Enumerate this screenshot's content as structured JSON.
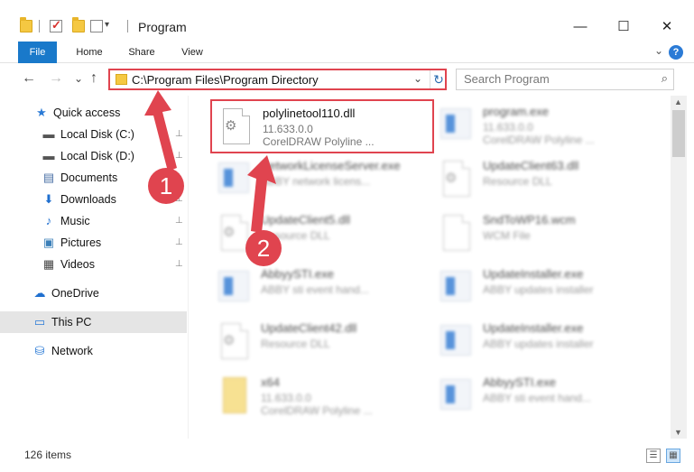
{
  "window": {
    "title": "Program",
    "minimize": "—",
    "maximize": "☐",
    "close": "✕"
  },
  "ribbon": {
    "tabs": [
      "File",
      "Home",
      "Share",
      "View"
    ],
    "expand": "⌄",
    "help": "?"
  },
  "nav": {
    "back": "←",
    "forward": "→",
    "recent": "⌄",
    "up": "↑",
    "address": "C:\\Program Files\\Program Directory",
    "address_dropdown": "⌄",
    "refresh": "↻",
    "search_placeholder": "Search Program",
    "search_icon": "⌕"
  },
  "sidebar": {
    "items": [
      {
        "label": "Quick access",
        "icon": "star-icon",
        "glyph": "★",
        "color": "#2b7bd6",
        "pinned": false
      },
      {
        "label": "Local Disk (C:)",
        "icon": "drive-icon",
        "glyph": "▬",
        "color": "#555555",
        "pinned": true
      },
      {
        "label": "Local Disk (D:)",
        "icon": "drive-icon",
        "glyph": "▬",
        "color": "#555555",
        "pinned": true
      },
      {
        "label": "Documents",
        "icon": "documents-icon",
        "glyph": "▤",
        "color": "#4a6fa5",
        "pinned": true
      },
      {
        "label": "Downloads",
        "icon": "download-icon",
        "glyph": "⬇",
        "color": "#1f6fcf",
        "pinned": true
      },
      {
        "label": "Music",
        "icon": "music-icon",
        "glyph": "♪",
        "color": "#1f6fcf",
        "pinned": true
      },
      {
        "label": "Pictures",
        "icon": "pictures-icon",
        "glyph": "▣",
        "color": "#3b7fb8",
        "pinned": true
      },
      {
        "label": "Videos",
        "icon": "videos-icon",
        "glyph": "▦",
        "color": "#444444",
        "pinned": true
      },
      {
        "label": "OneDrive",
        "icon": "cloud-icon",
        "glyph": "☁",
        "color": "#1f6fcf",
        "pinned": false
      },
      {
        "label": "This PC",
        "icon": "computer-icon",
        "glyph": "▭",
        "color": "#2b7bd6",
        "pinned": false
      },
      {
        "label": "Network",
        "icon": "network-icon",
        "glyph": "⛁",
        "color": "#2b7bd6",
        "pinned": false
      }
    ],
    "pin_glyph": "📌"
  },
  "files": [
    {
      "name": "polylinetool110.dll",
      "line2": "11.633.0.0",
      "line3": "CorelDRAW Polyline ...",
      "kind": "dll"
    },
    {
      "name": "program.exe",
      "line2": "11.633.0.0",
      "line3": "CorelDRAW Polyline ...",
      "kind": "exe"
    },
    {
      "name": "NetworkLicenseServer.exe",
      "line2": "ABBY network licens...",
      "line3": "",
      "kind": "exe"
    },
    {
      "name": "UpdateClient63.dll",
      "line2": "Resource DLL",
      "line3": "",
      "kind": "dll"
    },
    {
      "name": "UpdateClient5.dll",
      "line2": "Resource DLL",
      "line3": "",
      "kind": "dll"
    },
    {
      "name": "SndToWP16.wcm",
      "line2": "WCM File",
      "line3": "",
      "kind": "doc"
    },
    {
      "name": "AbbyySTI.exe",
      "line2": "ABBY sti event hand...",
      "line3": "",
      "kind": "exe"
    },
    {
      "name": "UpdateInstaller.exe",
      "line2": "ABBY updates installer",
      "line3": "",
      "kind": "exe"
    },
    {
      "name": "UpdateClient42.dll",
      "line2": "Resource DLL",
      "line3": "",
      "kind": "dll"
    },
    {
      "name": "UpdateInstaller.exe",
      "line2": "ABBY updates installer",
      "line3": "",
      "kind": "exe"
    },
    {
      "name": "x64",
      "line2": "11.633.0.0",
      "line3": "CorelDRAW Polyline ...",
      "kind": "zip"
    },
    {
      "name": "AbbyySTI.exe",
      "line2": "ABBY sti event hand...",
      "line3": "",
      "kind": "exe"
    }
  ],
  "status": {
    "count": "126 items"
  },
  "annotations": {
    "step1": "1",
    "step2": "2",
    "accent": "#e0444f"
  }
}
